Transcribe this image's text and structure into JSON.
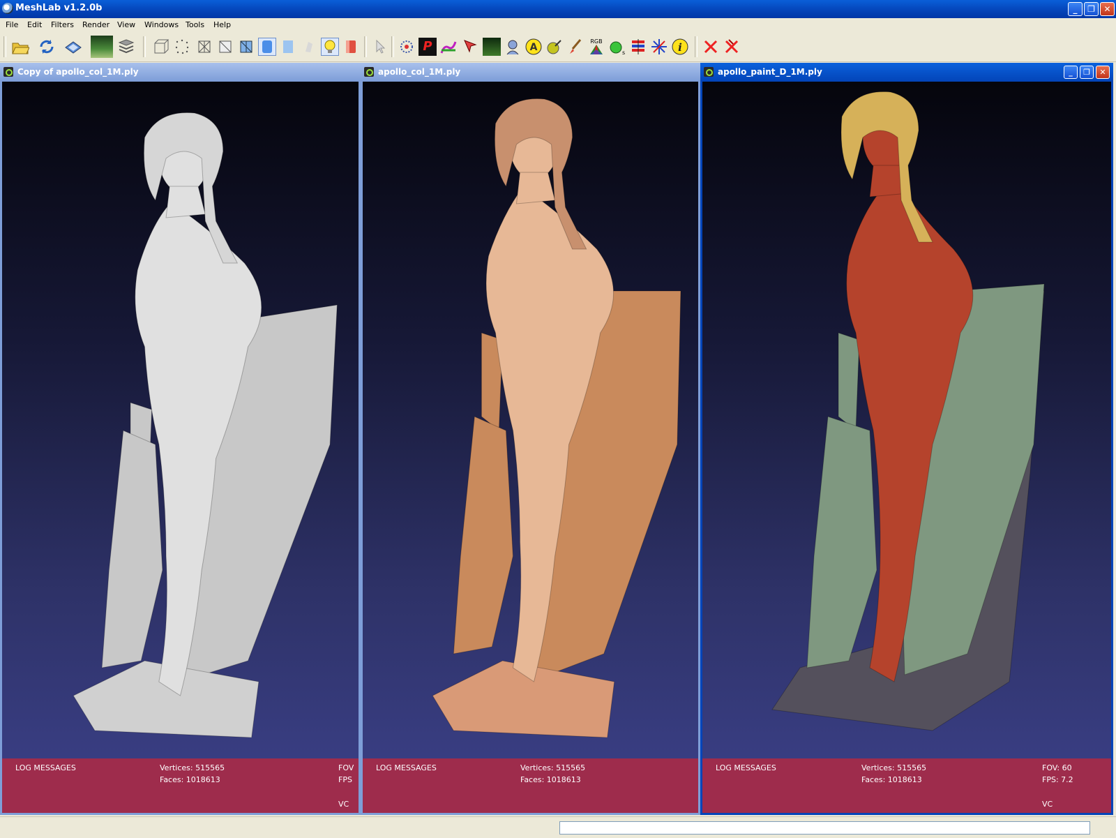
{
  "app": {
    "title": "MeshLab v1.2.0b"
  },
  "window_controls": {
    "minimize": "_",
    "restore": "❐",
    "close": "✕"
  },
  "menu": [
    "File",
    "Edit",
    "Filters",
    "Render",
    "View",
    "Windows",
    "Tools",
    "Help"
  ],
  "toolbar": {
    "groups": [
      [
        "open-icon",
        "reload-icon",
        "save-icon",
        "snapshot-icon",
        "layers-icon"
      ],
      [
        "bbox-icon",
        "points-icon",
        "wireframe-icon",
        "hidden-lines-icon",
        "flat-lines-icon",
        "smooth-icon",
        "flat-icon",
        "texture-icon",
        "light-icon",
        "backface-icon"
      ],
      [
        "select-tool-icon"
      ],
      [
        "measure-icon",
        "pick-points-icon",
        "paint-icon",
        "select-faces-icon",
        "image-align-icon",
        "manual-align-icon",
        "annotation-icon",
        "color-pick-icon",
        "brush-icon",
        "rgb-icon",
        "slice-icon",
        "layers-edit-icon",
        "align-axis-icon",
        "info-icon"
      ],
      [
        "close-mesh-icon",
        "close-all-icon"
      ]
    ],
    "rgb_label": "RGB",
    "annotation_letter": "A",
    "info_letter": "i"
  },
  "windows": [
    {
      "title": "Copy of apollo_col_1M.ply",
      "log_label": "LOG MESSAGES",
      "vertices": "Vertices: 515565",
      "faces": "Faces: 1018613",
      "fov": "FOV",
      "fps": "FPS",
      "mode": "VC",
      "active": false,
      "colors": {
        "body": "#e0e0e0",
        "drape": "#c8c8c8",
        "hair": "#d6d6d6",
        "base": "#d0d0d0"
      }
    },
    {
      "title": "apollo_col_1M.ply",
      "log_label": "LOG MESSAGES",
      "vertices": "Vertices: 515565",
      "faces": "Faces: 1018613",
      "active": false,
      "colors": {
        "body": "#e7b896",
        "drape": "#c98a5c",
        "hair": "#c8906e",
        "base": "#d99a77"
      }
    },
    {
      "title": "apollo_paint_D_1M.ply",
      "log_label": "LOG MESSAGES",
      "vertices": "Vertices: 515565",
      "faces": "Faces: 1018613",
      "fov": "FOV: 60",
      "fps": "FPS:     7.2",
      "mode": "VC",
      "active": true,
      "colors": {
        "body": "#b5432c",
        "drape": "#7f9880",
        "hair": "#d6b159",
        "base": "#54505c"
      }
    }
  ]
}
